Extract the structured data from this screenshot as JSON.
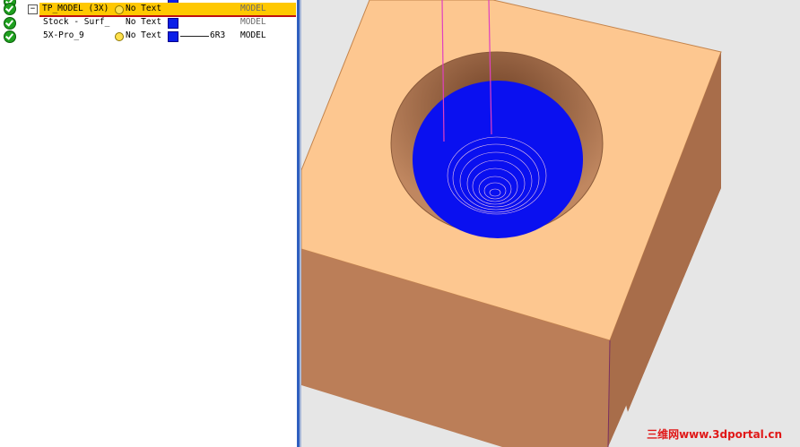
{
  "tree": {
    "rows": [
      {
        "name": "TP_MODEL (3X)",
        "text": "No Text",
        "type": "MODEL",
        "selected": true
      },
      {
        "name": "Stock - Surf_",
        "text": "No Text",
        "type": "MODEL",
        "selected": false
      },
      {
        "name": "5X-Pro_9",
        "text": "No Text",
        "tool": "6R3",
        "type": "MODEL",
        "selected": false
      }
    ],
    "expander_symbol": "−"
  },
  "viewport": {
    "colors": {
      "background": "#e6e6e6",
      "block_top": "#fdc790",
      "block_front": "#bb7e58",
      "block_side": "#a86d4a",
      "toolpath": "#0a10f0",
      "tool_axis": "#e040c0"
    }
  },
  "watermark": {
    "text": "三维网www.3dportal.cn"
  }
}
